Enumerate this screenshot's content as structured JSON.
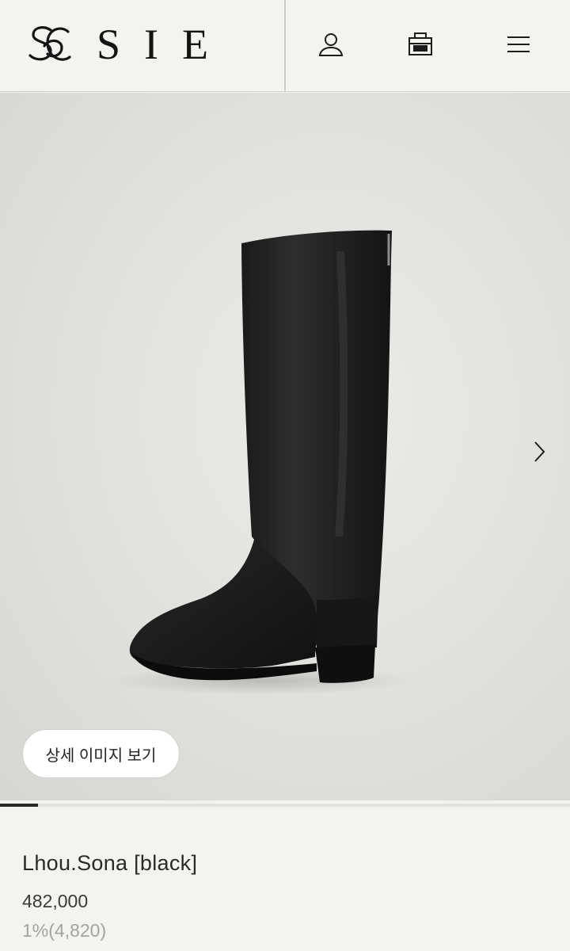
{
  "brand": {
    "name": "SIE",
    "logo_icon": "sc-monogram-logo"
  },
  "header": {
    "icons": {
      "account": "user-icon",
      "cart": "shopping-bag-icon",
      "menu": "hamburger-menu-icon"
    }
  },
  "gallery": {
    "next_icon": "chevron-right-icon",
    "detail_button_label": "상세 이미지 보기",
    "progress": 0.066
  },
  "product": {
    "name": "Lhou.Sona [black]",
    "price": "482,000",
    "points": "1%(4,820)"
  },
  "colors": {
    "background": "#f3f3ef",
    "text": "#1c1c1c",
    "muted": "#a3a3a3",
    "progress": "#2a2a2a"
  }
}
